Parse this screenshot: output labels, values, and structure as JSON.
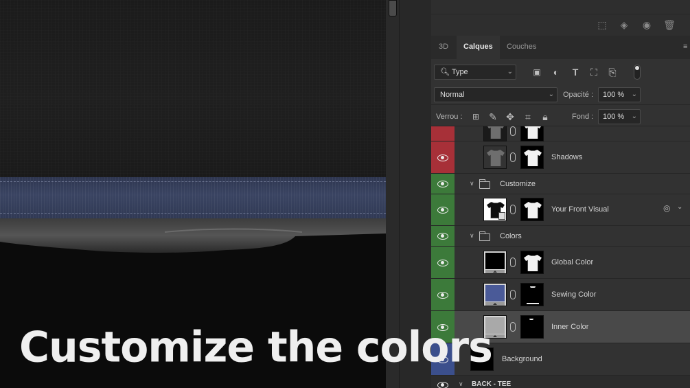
{
  "canvas": {
    "caption": "Customize the colors",
    "colors": {
      "fabric": "#1c1c1c",
      "band": "#3a4462",
      "background": "#0b0b0b"
    }
  },
  "toolbar": {
    "icons": [
      "marquee-icon",
      "mask-diamond-icon",
      "eye-icon",
      "trash-icon"
    ]
  },
  "tabs": [
    {
      "label": "3D",
      "active": false
    },
    {
      "label": "Calques",
      "active": true
    },
    {
      "label": "Couches",
      "active": false
    }
  ],
  "filter": {
    "type_label": "Type",
    "icons": [
      "image-filter-icon",
      "adjustment-filter-icon",
      "type-filter-icon",
      "shape-filter-icon",
      "smart-object-filter-icon",
      "filter-toggle"
    ]
  },
  "blend": {
    "mode": "Normal",
    "opacity_label": "Opacité :",
    "opacity_value": "100 %"
  },
  "lock": {
    "label": "Verrou :",
    "fill_label": "Fond :",
    "fill_value": "100 %",
    "icons": [
      "lock-transparent-icon",
      "lock-paint-icon",
      "lock-move-icon",
      "lock-artboard-icon",
      "lock-all-icon"
    ]
  },
  "layers": [
    {
      "name": "",
      "type": "layer",
      "visibility_color": "#a73038",
      "partial": true
    },
    {
      "name": "Shadows",
      "type": "layer",
      "visibility_color": "#a73038"
    },
    {
      "name": "Customize",
      "type": "group",
      "visibility_color": "#3c7a3a"
    },
    {
      "name": "Your Front Visual",
      "type": "smart-object",
      "visibility_color": "#3c7a3a"
    },
    {
      "name": "Colors",
      "type": "group",
      "visibility_color": "#3c7a3a"
    },
    {
      "name": "Global Color",
      "type": "fill",
      "swatch": "#000000",
      "visibility_color": "#3c7a3a"
    },
    {
      "name": "Sewing Color",
      "type": "fill",
      "swatch": "#4a5a98",
      "visibility_color": "#3c7a3a"
    },
    {
      "name": "Inner Color",
      "type": "fill",
      "swatch": "#a9a9a9",
      "visibility_color": "#3c7a3a",
      "selected": true
    },
    {
      "name": "Background",
      "type": "layer",
      "visibility_color": "#3b4f8c"
    },
    {
      "name": "BACK - TEE",
      "type": "group"
    }
  ]
}
